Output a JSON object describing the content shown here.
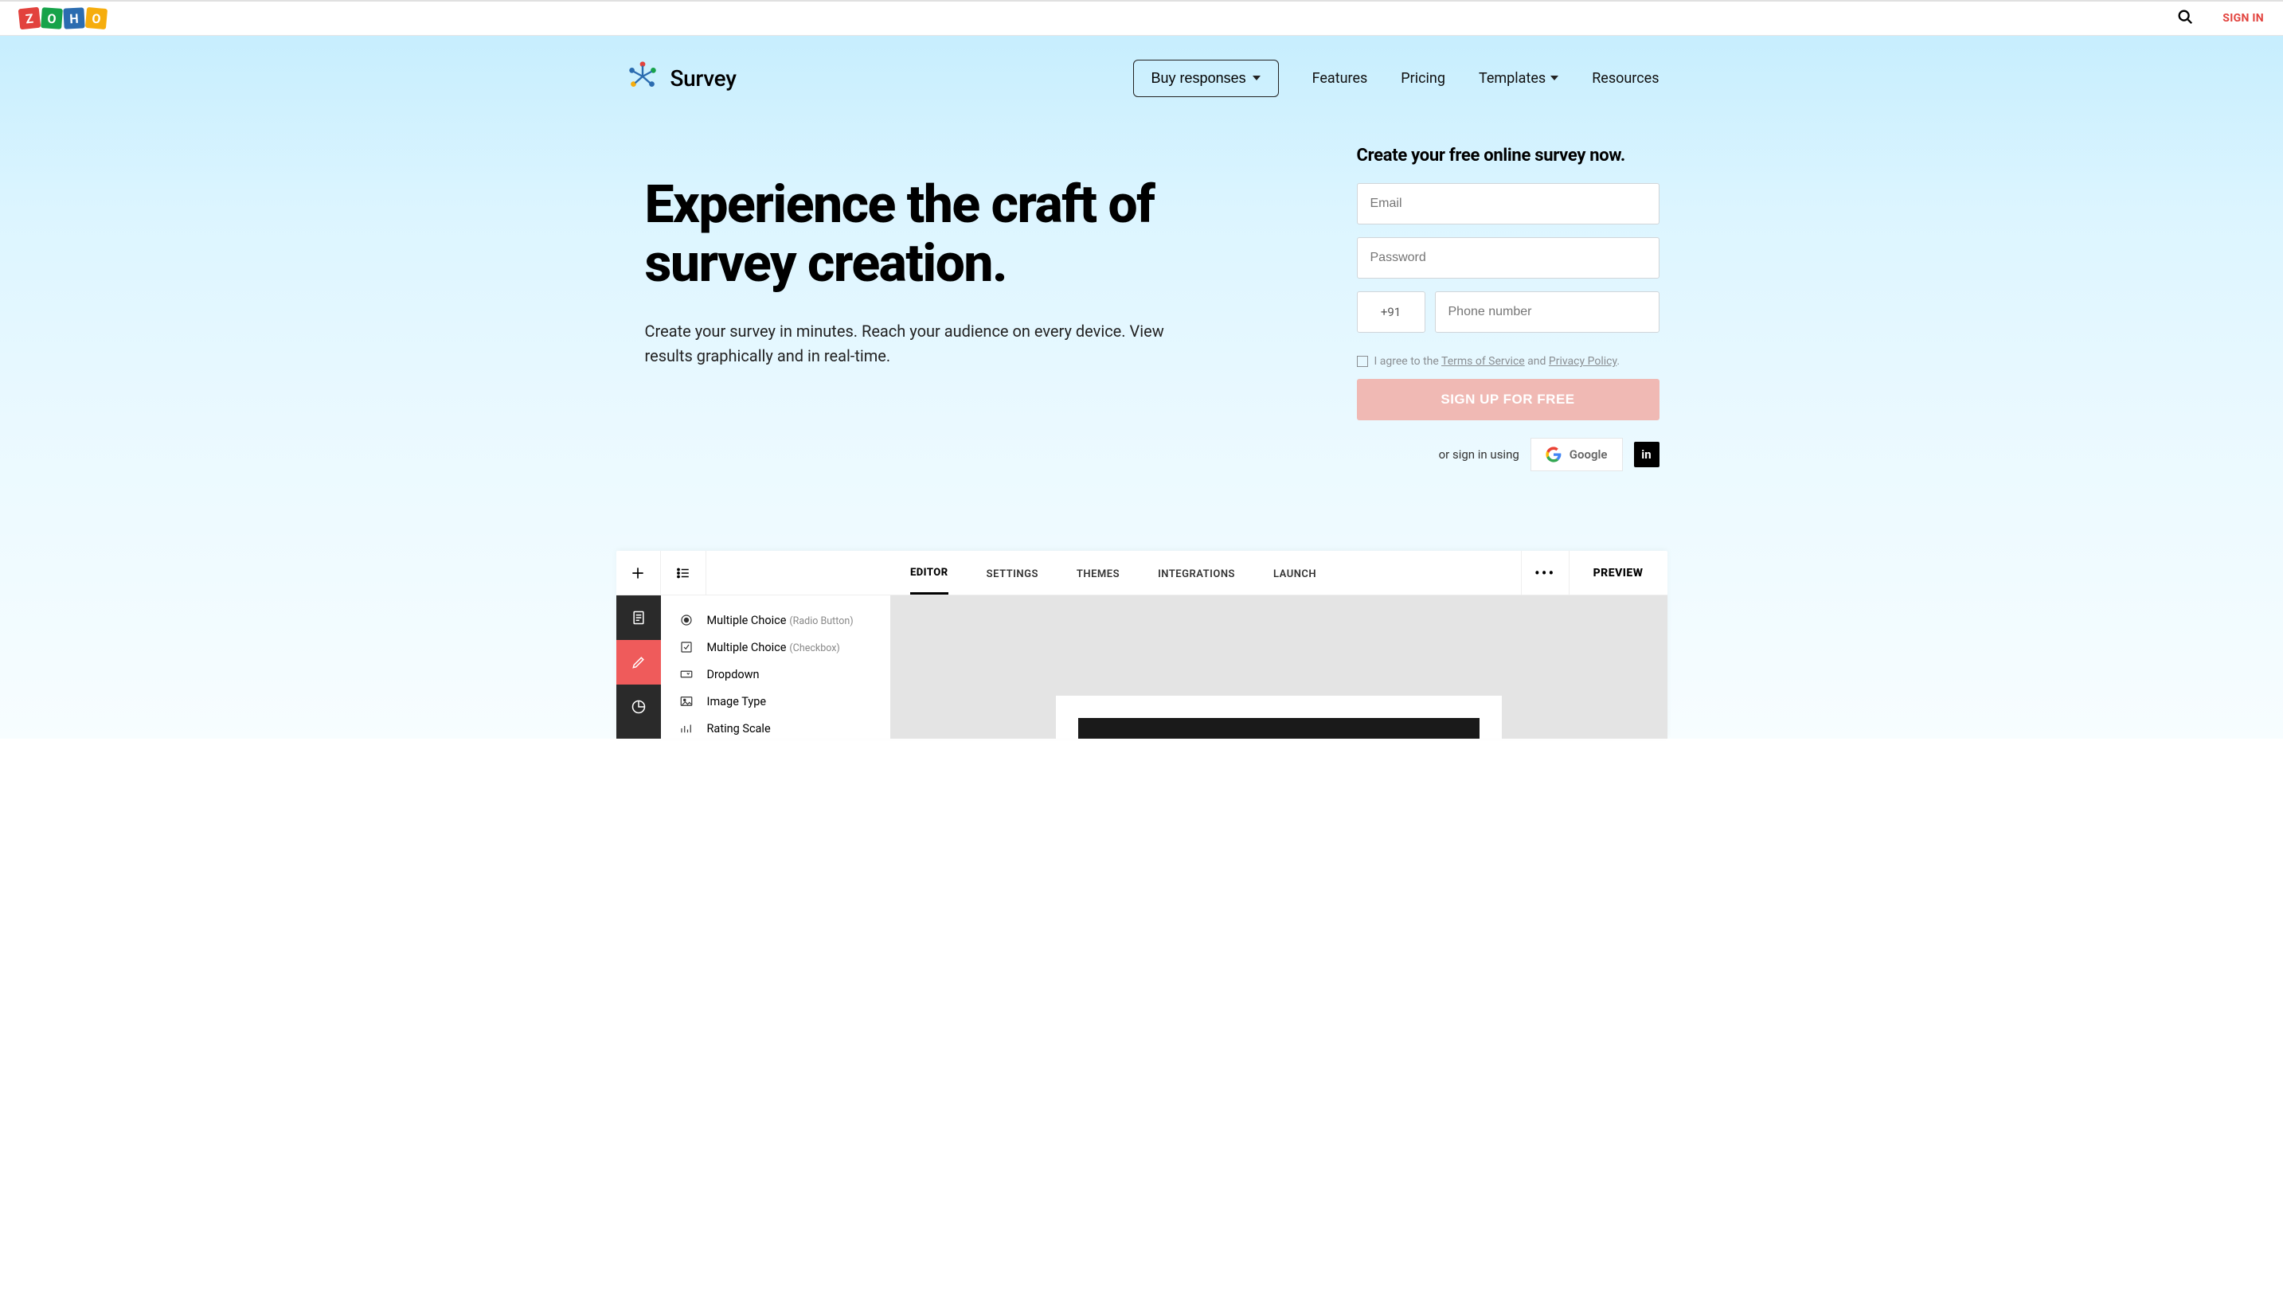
{
  "top": {
    "sign_in": "SIGN IN"
  },
  "nav": {
    "product_name": "Survey",
    "buy_responses": "Buy responses",
    "links": [
      "Features",
      "Pricing",
      "Templates",
      "Resources"
    ]
  },
  "hero": {
    "title": "Experience the craft of survey creation.",
    "subtitle": "Create your survey in minutes. Reach your audience on every device. View results graphically and in real-time."
  },
  "signup": {
    "title": "Create your free online survey now.",
    "email_placeholder": "Email",
    "password_placeholder": "Password",
    "phone_code": "+91",
    "phone_placeholder": "Phone number",
    "agree_prefix": "I agree to the ",
    "terms": "Terms of Service",
    "agree_mid": " and ",
    "privacy": "Privacy Policy",
    "agree_suffix": ".",
    "button": "SIGN UP FOR FREE",
    "alt_text": "or sign in using",
    "google": "Google",
    "linkedin": "in"
  },
  "editor": {
    "tabs": [
      "EDITOR",
      "SETTINGS",
      "THEMES",
      "INTEGRATIONS",
      "LAUNCH"
    ],
    "active_tab": 0,
    "preview": "PREVIEW",
    "questions": [
      {
        "label": "Multiple Choice",
        "sub": "(Radio Button)"
      },
      {
        "label": "Multiple Choice",
        "sub": "(Checkbox)"
      },
      {
        "label": "Dropdown",
        "sub": ""
      },
      {
        "label": "Image Type",
        "sub": ""
      },
      {
        "label": "Rating Scale",
        "sub": ""
      }
    ]
  }
}
